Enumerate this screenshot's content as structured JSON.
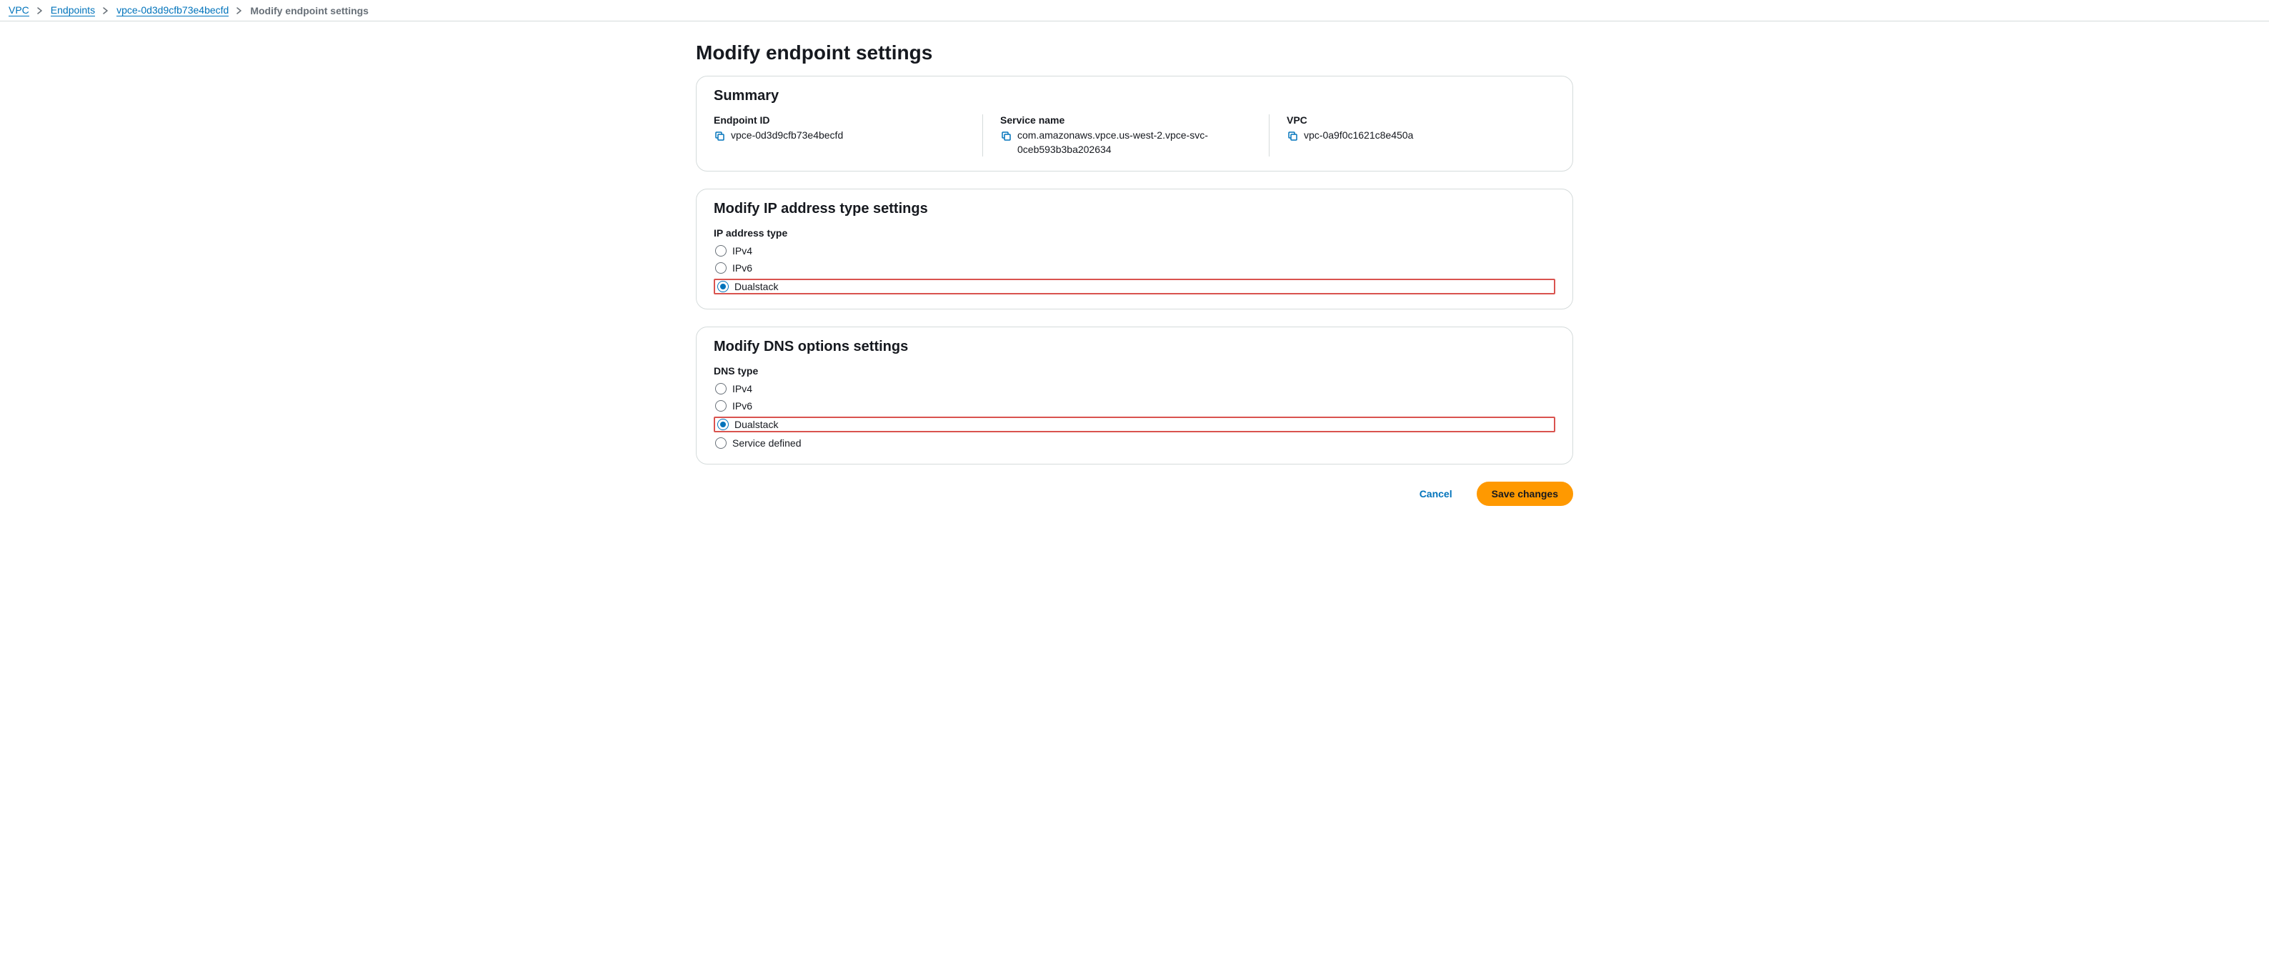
{
  "breadcrumb": {
    "items": [
      "VPC",
      "Endpoints",
      "vpce-0d3d9cfb73e4becfd"
    ],
    "current": "Modify endpoint settings"
  },
  "page_title": "Modify endpoint settings",
  "summary": {
    "title": "Summary",
    "items": [
      {
        "label": "Endpoint ID",
        "value": "vpce-0d3d9cfb73e4becfd"
      },
      {
        "label": "Service name",
        "value": "com.amazonaws.vpce.us-west-2.vpce-svc-0ceb593b3ba202634"
      },
      {
        "label": "VPC",
        "value": "vpc-0a9f0c1621c8e450a"
      }
    ]
  },
  "ip_section": {
    "title": "Modify IP address type settings",
    "field_label": "IP address type",
    "options": [
      {
        "label": "IPv4",
        "selected": false,
        "highlight": false
      },
      {
        "label": "IPv6",
        "selected": false,
        "highlight": false
      },
      {
        "label": "Dualstack",
        "selected": true,
        "highlight": true
      }
    ]
  },
  "dns_section": {
    "title": "Modify DNS options settings",
    "field_label": "DNS type",
    "options": [
      {
        "label": "IPv4",
        "selected": false,
        "highlight": false
      },
      {
        "label": "IPv6",
        "selected": false,
        "highlight": false
      },
      {
        "label": "Dualstack",
        "selected": true,
        "highlight": true
      },
      {
        "label": "Service defined",
        "selected": false,
        "highlight": false
      }
    ]
  },
  "buttons": {
    "cancel": "Cancel",
    "save": "Save changes"
  }
}
